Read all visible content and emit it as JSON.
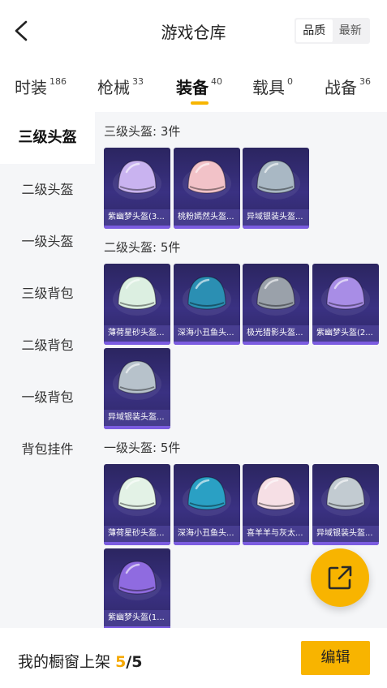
{
  "header": {
    "title": "游戏仓库",
    "sort_options": [
      "品质",
      "最新"
    ],
    "sort_selected": "品质"
  },
  "tabs": [
    {
      "label": "时装",
      "count": "186"
    },
    {
      "label": "枪械",
      "count": "33"
    },
    {
      "label": "装备",
      "count": "40",
      "active": true
    },
    {
      "label": "载具",
      "count": "0"
    },
    {
      "label": "战备",
      "count": "36"
    }
  ],
  "sidebar": {
    "items": [
      "三级头盔",
      "二级头盔",
      "一级头盔",
      "三级背包",
      "二级背包",
      "一级背包",
      "背包挂件"
    ],
    "active": "三级头盔"
  },
  "sections": [
    {
      "title": "三级头盔: 3件",
      "items": [
        {
          "name": "紫幽梦头盔(3...",
          "color": "#c9b3f0"
        },
        {
          "name": "桃粉嫣然头盔...",
          "color": "#f2c2c8"
        },
        {
          "name": "异域银装头盔...",
          "color": "#a9b8c4"
        }
      ]
    },
    {
      "title": "二级头盔: 5件",
      "items": [
        {
          "name": "薄荷星砂头盔...",
          "color": "#dcefe1"
        },
        {
          "name": "深海小丑鱼头...",
          "color": "#2b8fb3"
        },
        {
          "name": "极光猎影头盔...",
          "color": "#9aa1aa"
        },
        {
          "name": "紫幽梦头盔(2...",
          "color": "#a88de6"
        },
        {
          "name": "异域银装头盔...",
          "color": "#b7c2cb"
        }
      ]
    },
    {
      "title": "一级头盔: 5件",
      "items": [
        {
          "name": "薄荷星砂头盔...",
          "color": "#e3f2e6"
        },
        {
          "name": "深海小丑鱼头...",
          "color": "#2aa0c4"
        },
        {
          "name": "喜羊羊与灰太...",
          "color": "#f6dfe5"
        },
        {
          "name": "异域银装头盔...",
          "color": "#c2cbd1"
        },
        {
          "name": "紫幽梦头盔(1...",
          "color": "#8f6be0"
        }
      ]
    }
  ],
  "bottom": {
    "label": "我的橱窗上架",
    "current": "5",
    "separator": "/",
    "total": "5",
    "edit_label": "编辑"
  },
  "colors": {
    "accent": "#f8b400",
    "card_bg": "#2f2870",
    "card_bar": "#7b5ce0"
  }
}
